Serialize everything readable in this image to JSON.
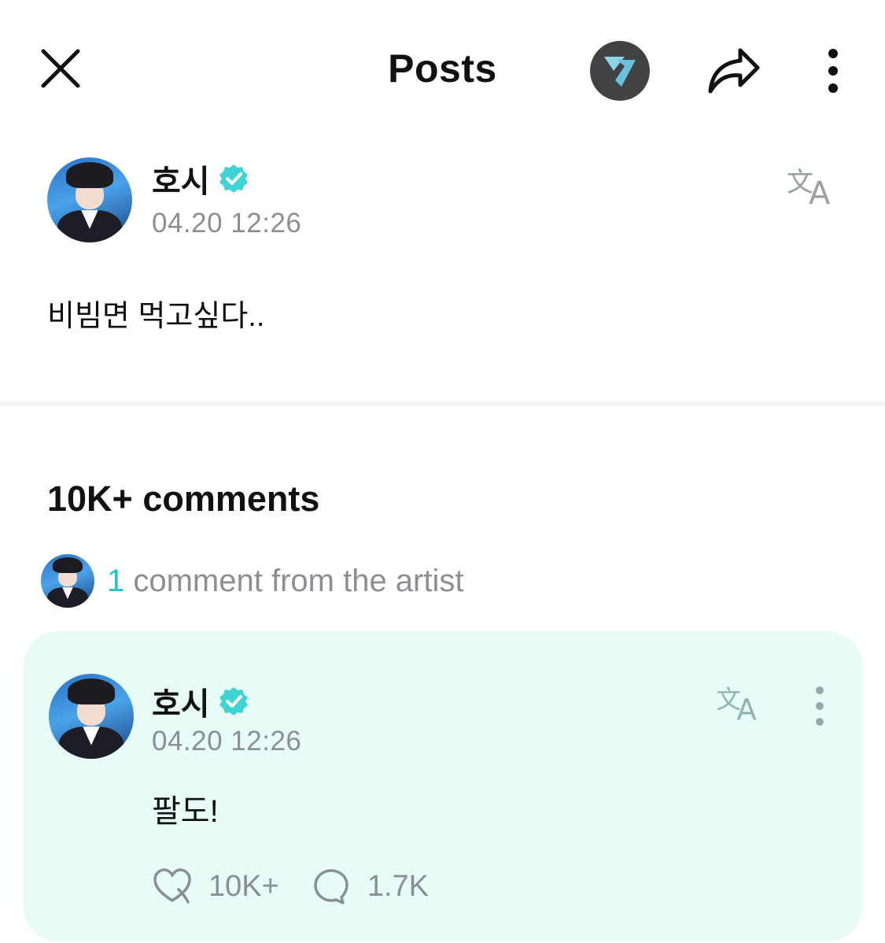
{
  "header": {
    "title": "Posts",
    "close_icon": "close-icon",
    "community_icon": "community-logo-icon",
    "share_icon": "share-icon",
    "more_icon": "more-vertical-icon"
  },
  "post": {
    "author": {
      "name": "호시",
      "verified": true,
      "avatar": "avatar"
    },
    "time": "04.20 12:26",
    "translate_icon": "translate-icon",
    "body": "비빔면 먹고싶다.."
  },
  "comments": {
    "title": "10K+ comments",
    "artist_summary": {
      "count": "1",
      "text": " comment from the artist"
    },
    "items": [
      {
        "author": {
          "name": "호시",
          "verified": true
        },
        "time": "04.20 12:26",
        "body": "팔도!",
        "likes": "10K+",
        "replies": "1.7K",
        "like_icon": "heart-sticker-icon",
        "reply_icon": "speech-bubble-icon"
      }
    ]
  },
  "colors": {
    "accent": "#1fc6c6",
    "verified": "#3fd3d3",
    "card_bg": "#e7fbf7",
    "muted_text": "#8b8f94"
  }
}
